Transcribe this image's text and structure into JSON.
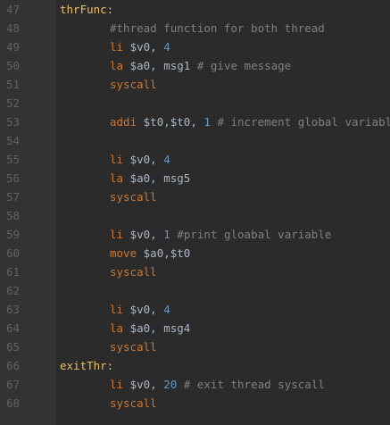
{
  "editor": {
    "line_numbers": [
      "47",
      "48",
      "49",
      "50",
      "51",
      "52",
      "53",
      "54",
      "55",
      "56",
      "57",
      "58",
      "59",
      "60",
      "61",
      "62",
      "63",
      "64",
      "65",
      "66",
      "67",
      "68"
    ],
    "lines": [
      {
        "label": "thrFunc:"
      },
      {
        "comment": "#thread function for both thread"
      },
      {
        "kw": "li",
        "regs": "$v0,",
        "num": "4"
      },
      {
        "kw": "la",
        "regs": "$a0, msg1",
        "comment": "# give message"
      },
      {
        "kw": "syscall"
      },
      {},
      {
        "kw": "addi",
        "regs": "$t0,$t0,",
        "num": "1",
        "comment": "# increment global variable"
      },
      {},
      {
        "kw": "li",
        "regs": "$v0,",
        "num": "4"
      },
      {
        "kw": "la",
        "regs": "$a0, msg5"
      },
      {
        "kw": "syscall"
      },
      {},
      {
        "kw": "li",
        "regs": "$v0,",
        "num": "1",
        "comment": "#print gloabal variable"
      },
      {
        "kw": "move",
        "regs": "$a0,$t0"
      },
      {
        "kw": "syscall"
      },
      {},
      {
        "kw": "li",
        "regs": "$v0,",
        "num": "4"
      },
      {
        "kw": "la",
        "regs": "$a0, msg4"
      },
      {
        "kw": "syscall"
      },
      {
        "label": "exitThr:"
      },
      {
        "kw": "li",
        "regs": "$v0,",
        "num": "20",
        "comment": "# exit thread syscall"
      },
      {
        "kw": "syscall"
      }
    ]
  }
}
